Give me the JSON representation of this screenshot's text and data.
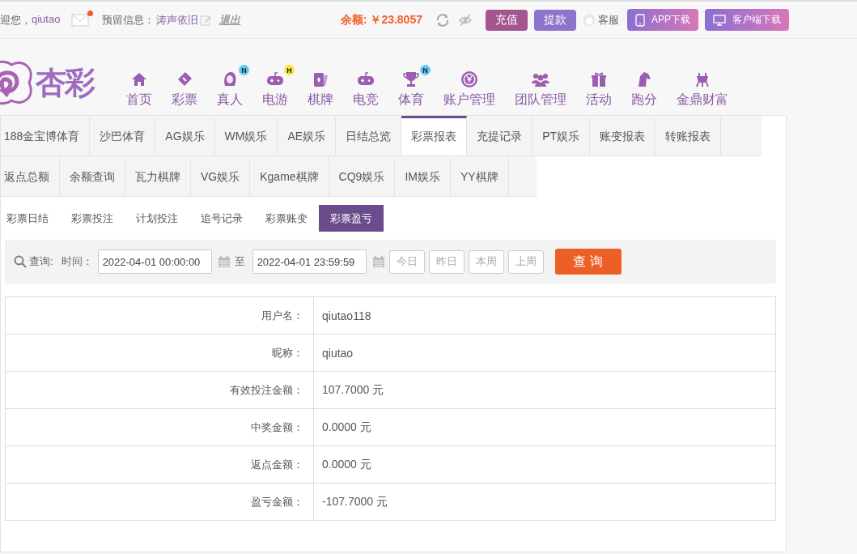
{
  "top_bar": {
    "greeting": "迎您，",
    "username": "qiutao",
    "has_new_mail": true,
    "reserved_label": "预留信息：",
    "reserved_value": "涛声依旧",
    "logout": "退出",
    "balance_label": "余额:",
    "balance": "￥23.8057",
    "buttons": [
      {
        "label": "充值",
        "kind": "deposit"
      },
      {
        "label": "提款",
        "kind": "withdraw"
      }
    ],
    "service": "客服",
    "downloads": [
      {
        "label": "APP下载",
        "kind": "phone"
      },
      {
        "label": "客户端下载",
        "kind": "desktop"
      }
    ]
  },
  "logo": {
    "text": "杏彩"
  },
  "nav": [
    {
      "label": "首页"
    },
    {
      "label": "彩票"
    },
    {
      "label": "真人",
      "badge": {
        "text": "N",
        "color": "#5fcdf2"
      }
    },
    {
      "label": "电游",
      "badge": {
        "text": "H",
        "color": "#f5ea3a"
      }
    },
    {
      "label": "棋牌"
    },
    {
      "label": "电竞"
    },
    {
      "label": "体育",
      "badge": {
        "text": "N",
        "color": "#5fcdf2"
      }
    },
    {
      "label": "账户管理"
    },
    {
      "label": "团队管理"
    },
    {
      "label": "活动"
    },
    {
      "label": "跑分"
    },
    {
      "label": "金鼎财富"
    }
  ],
  "tab_rows": [
    {
      "tabs": [
        {
          "label": "188金宝博体育",
          "selected": false
        },
        {
          "label": "沙巴体育",
          "selected": false
        },
        {
          "label": "AG娱乐",
          "selected": false
        },
        {
          "label": "WM娱乐",
          "selected": false
        },
        {
          "label": "AE娱乐",
          "selected": false
        },
        {
          "label": "日结总览",
          "selected": false
        },
        {
          "label": "彩票报表",
          "selected": true
        },
        {
          "label": "充提记录",
          "selected": false
        },
        {
          "label": "PT娱乐",
          "selected": false
        },
        {
          "label": "账变报表",
          "selected": false
        },
        {
          "label": "转账报表",
          "selected": false
        }
      ]
    },
    {
      "tabs": [
        {
          "label": "返点总额",
          "selected": false
        },
        {
          "label": "余额查询",
          "selected": false
        },
        {
          "label": "瓦力棋牌",
          "selected": false
        },
        {
          "label": "VG娱乐",
          "selected": false
        },
        {
          "label": "Kgame棋牌",
          "selected": false
        },
        {
          "label": "CQ9娱乐",
          "selected": false
        },
        {
          "label": "IM娱乐",
          "selected": false
        },
        {
          "label": "YY棋牌",
          "selected": false
        }
      ]
    }
  ],
  "sub_tabs": [
    {
      "label": "彩票日结",
      "selected": false
    },
    {
      "label": "彩票投注",
      "selected": false
    },
    {
      "label": "计划投注",
      "selected": false
    },
    {
      "label": "追号记录",
      "selected": false
    },
    {
      "label": "彩票账变",
      "selected": false
    },
    {
      "label": "彩票盈亏",
      "selected": true
    }
  ],
  "query": {
    "label": "查询:",
    "time_label": "时间：",
    "start": "2022-04-01 00:00:00",
    "to": "至",
    "end": "2022-04-01 23:59:59",
    "quick": [
      "今日",
      "昨日",
      "本周",
      "上周"
    ],
    "submit": "查 询"
  },
  "details": [
    {
      "label": "用户名：",
      "value": "qiutao118"
    },
    {
      "label": "昵称：",
      "value": "qiutao"
    },
    {
      "label": "有效投注金额：",
      "value": "107.7000 元"
    },
    {
      "label": "中奖金额：",
      "value": "0.0000 元"
    },
    {
      "label": "返点金额：",
      "value": "0.0000 元"
    },
    {
      "label": "盈亏金额：",
      "value": "-107.7000 元"
    }
  ]
}
